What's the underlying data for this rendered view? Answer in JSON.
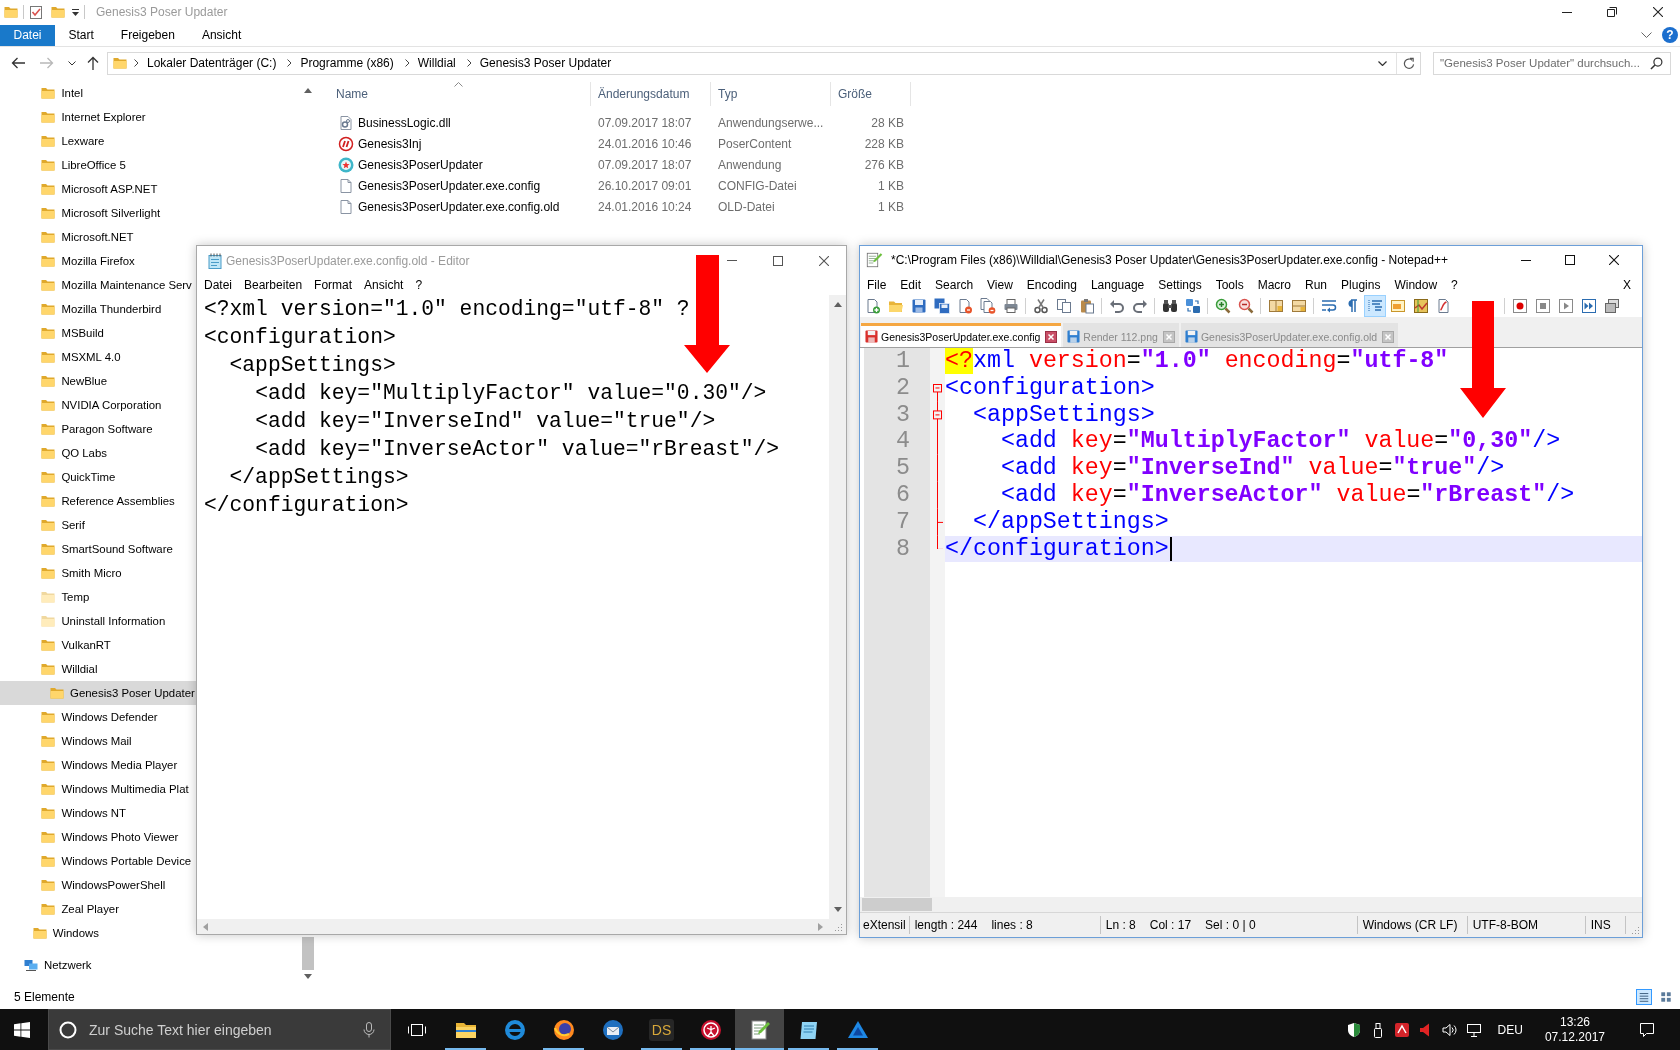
{
  "explorer": {
    "title": "Genesis3 Poser Updater",
    "active": false,
    "ribbon_tabs": [
      {
        "label": "Datei",
        "selected": true
      },
      {
        "label": "Start",
        "selected": false
      },
      {
        "label": "Freigeben",
        "selected": false
      },
      {
        "label": "Ansicht",
        "selected": false
      }
    ],
    "help": "?",
    "nav_buttons": [
      {
        "disabled": false
      },
      {
        "disabled": true
      },
      {
        "disabled": false
      },
      {
        "disabled": false
      }
    ],
    "breadcrumbs": [
      "Lokaler Datenträger (C:)",
      "Programme (x86)",
      "Willdial",
      "Genesis3 Poser Updater"
    ],
    "search": {
      "placeholder": "\"Genesis3 Poser Updater\" durchsuch..."
    },
    "navigation": [
      {
        "children": [
          {
            "children": [
              {
                "label": "Intel",
                "kind": "folder",
                "selected": false
              },
              {
                "label": "Internet Explorer",
                "kind": "folder",
                "selected": false
              },
              {
                "label": "Lexware",
                "kind": "folder",
                "selected": false
              },
              {
                "label": "LibreOffice 5",
                "kind": "folder",
                "selected": false
              },
              {
                "label": "Microsoft ASP.NET",
                "kind": "folder",
                "selected": false
              },
              {
                "label": "Microsoft Silverlight",
                "kind": "folder",
                "selected": false
              },
              {
                "label": "Microsoft.NET",
                "kind": "folder",
                "selected": false
              },
              {
                "label": "Mozilla Firefox",
                "kind": "folder",
                "selected": false
              },
              {
                "label": "Mozilla Maintenance Serv",
                "kind": "folder",
                "selected": false
              },
              {
                "label": "Mozilla Thunderbird",
                "kind": "folder",
                "selected": false
              },
              {
                "label": "MSBuild",
                "kind": "folder",
                "selected": false
              },
              {
                "label": "MSXML 4.0",
                "kind": "folder",
                "selected": false
              },
              {
                "label": "NewBlue",
                "kind": "folder",
                "selected": false
              },
              {
                "label": "NVIDIA Corporation",
                "kind": "folder",
                "selected": false
              },
              {
                "label": "Paragon Software",
                "kind": "folder",
                "selected": false
              },
              {
                "label": "QO Labs",
                "kind": "folder",
                "selected": false
              },
              {
                "label": "QuickTime",
                "kind": "folder",
                "selected": false
              },
              {
                "label": "Reference Assemblies",
                "kind": "folder",
                "selected": false
              },
              {
                "label": "Serif",
                "kind": "folder",
                "selected": false
              },
              {
                "label": "SmartSound Software",
                "kind": "folder",
                "selected": false
              },
              {
                "label": "Smith Micro",
                "kind": "folder",
                "selected": false
              },
              {
                "label": "Temp",
                "kind": "hidden-folder",
                "selected": false
              },
              {
                "label": "Uninstall Information",
                "kind": "hidden-folder",
                "selected": false
              },
              {
                "label": "VulkanRT",
                "kind": "folder",
                "selected": false
              },
              {
                "label": "Willdial",
                "kind": "folder",
                "selected": false,
                "children": [
                  {
                    "label": "Genesis3 Poser Updater",
                    "kind": "folder",
                    "selected": true
                  }
                ]
              },
              {
                "label": "Windows Defender",
                "kind": "folder",
                "selected": false
              },
              {
                "label": "Windows Mail",
                "kind": "folder",
                "selected": false
              },
              {
                "label": "Windows Media Player",
                "kind": "folder",
                "selected": false
              },
              {
                "label": "Windows Multimedia Plat",
                "kind": "folder",
                "selected": false
              },
              {
                "label": "Windows NT",
                "kind": "folder",
                "selected": false
              },
              {
                "label": "Windows Photo Viewer",
                "kind": "folder",
                "selected": false
              },
              {
                "label": "Windows Portable Device",
                "kind": "folder",
                "selected": false
              },
              {
                "label": "WindowsPowerShell",
                "kind": "folder",
                "selected": false
              },
              {
                "label": "Zeal Player",
                "kind": "folder",
                "selected": false
              }
            ]
          },
          {
            "label": "Windows",
            "kind": "folder",
            "selected": false
          }
        ]
      },
      {
        "label": "Netzwerk",
        "kind": "network",
        "selected": false
      }
    ],
    "columns": [
      {
        "label": "Name",
        "sorted": true
      },
      {
        "label": "Änderungsdatum",
        "sorted": false
      },
      {
        "label": "Typ",
        "sorted": false
      },
      {
        "label": "Größe",
        "sorted": false
      }
    ],
    "files": [
      {
        "kind": "library",
        "name": "BusinessLogic.dll",
        "modified": "07.09.2017 18:07",
        "type": "Anwendungserwe...",
        "size": "28 KB"
      },
      {
        "kind": "poser",
        "name": "Genesis3Inj",
        "modified": "24.01.2016 10:46",
        "type": "PoserContent",
        "size": "228 KB"
      },
      {
        "kind": "application",
        "name": "Genesis3PoserUpdater",
        "modified": "07.09.2017 18:07",
        "type": "Anwendung",
        "size": "276 KB"
      },
      {
        "kind": "document",
        "name": "Genesis3PoserUpdater.exe.config",
        "modified": "26.10.2017 09:01",
        "type": "CONFIG-Datei",
        "size": "1 KB"
      },
      {
        "kind": "document",
        "name": "Genesis3PoserUpdater.exe.config.old",
        "modified": "24.01.2016 10:24",
        "type": "OLD-Datei",
        "size": "1 KB"
      }
    ],
    "status": "5 Elemente",
    "view_buttons": [
      {
        "selected": true
      },
      {
        "selected": false
      }
    ]
  },
  "editor": {
    "title": "Genesis3PoserUpdater.exe.config.old - Editor",
    "active": false,
    "menu": [
      "Datei",
      "Bearbeiten",
      "Format",
      "Ansicht",
      "?"
    ],
    "lines": [
      "<?xml version=\"1.0\" encoding=\"utf-8\" ?",
      "<configuration>",
      "  <appSettings>",
      "    <add key=\"MultiplyFactor\" value=\"0.30\"/>",
      "    <add key=\"InverseInd\" value=\"true\"/>",
      "    <add key=\"InverseActor\" value=\"rBreast\"/>",
      "  </appSettings>",
      "</configuration>"
    ]
  },
  "notepad_plus_plus": {
    "title": "*C:\\Program Files (x86)\\Willdial\\Genesis3 Poser Updater\\Genesis3PoserUpdater.exe.config - Notepad++",
    "active": true,
    "menu": [
      "File",
      "Edit",
      "Search",
      "View",
      "Encoding",
      "Language",
      "Settings",
      "Tools",
      "Macro",
      "Run",
      "Plugins",
      "Window",
      "?"
    ],
    "close_document": "X",
    "toolbar": [
      [
        {
          "pressed": false
        },
        {
          "pressed": false
        },
        {
          "pressed": false
        },
        {
          "pressed": false
        },
        {
          "pressed": false
        },
        {
          "pressed": false
        },
        {
          "pressed": false
        }
      ],
      [
        {
          "pressed": false
        },
        {
          "pressed": false
        },
        {
          "pressed": false
        }
      ],
      [
        {
          "pressed": false
        },
        {
          "pressed": false
        }
      ],
      [
        {
          "pressed": false
        },
        {
          "pressed": false
        }
      ],
      [
        {
          "pressed": false
        },
        {
          "pressed": false
        }
      ],
      [
        {
          "pressed": false
        },
        {
          "pressed": false
        }
      ],
      [
        {
          "pressed": false
        },
        {
          "pressed": false
        },
        {
          "pressed": true
        },
        {
          "pressed": false
        },
        {
          "pressed": false
        },
        {
          "pressed": false
        }
      ],
      [
        {
          "pressed": false
        },
        {
          "pressed": false
        },
        {
          "pressed": false
        },
        {
          "pressed": false
        },
        {
          "pressed": false
        }
      ]
    ],
    "tabs": [
      {
        "label": "Genesis3PoserUpdater.exe.config",
        "selected": true,
        "modified": true
      },
      {
        "label": "Render 112.png",
        "selected": false,
        "modified": false
      },
      {
        "label": "Genesis3PoserUpdater.exe.config.old",
        "selected": false,
        "modified": false
      }
    ],
    "lines": [
      {
        "number": "1",
        "kind": "plain",
        "current": false,
        "tokens": [
          {
            "text": "<?",
            "kind": "pi"
          },
          {
            "text": "xml",
            "kind": "tag"
          },
          {
            "text": " version",
            "kind": "attr"
          },
          {
            "text": "=",
            "kind": "plain"
          },
          {
            "text": "\"1.0\"",
            "kind": "value"
          },
          {
            "text": " encoding",
            "kind": "attr"
          },
          {
            "text": "=",
            "kind": "plain"
          },
          {
            "text": "\"utf-8\"",
            "kind": "value"
          }
        ]
      },
      {
        "number": "2",
        "kind": "fold-start",
        "current": false,
        "tokens": [
          {
            "text": "<configuration>",
            "kind": "tag"
          }
        ]
      },
      {
        "number": "3",
        "kind": "fold-start",
        "current": false,
        "tokens": [
          {
            "text": "  <appSettings>",
            "kind": "tag"
          }
        ]
      },
      {
        "number": "4",
        "kind": "fold-body",
        "current": false,
        "tokens": [
          {
            "text": "    <add",
            "kind": "tag"
          },
          {
            "text": " key",
            "kind": "attr"
          },
          {
            "text": "=",
            "kind": "plain"
          },
          {
            "text": "\"MultiplyFactor\"",
            "kind": "value"
          },
          {
            "text": " value",
            "kind": "attr"
          },
          {
            "text": "=",
            "kind": "plain"
          },
          {
            "text": "\"0,30\"",
            "kind": "value"
          },
          {
            "text": "/>",
            "kind": "tag"
          }
        ]
      },
      {
        "number": "5",
        "kind": "fold-body",
        "current": false,
        "tokens": [
          {
            "text": "    <add",
            "kind": "tag"
          },
          {
            "text": " key",
            "kind": "attr"
          },
          {
            "text": "=",
            "kind": "plain"
          },
          {
            "text": "\"InverseInd\"",
            "kind": "value"
          },
          {
            "text": " value",
            "kind": "attr"
          },
          {
            "text": "=",
            "kind": "plain"
          },
          {
            "text": "\"true\"",
            "kind": "value"
          },
          {
            "text": "/>",
            "kind": "tag"
          }
        ]
      },
      {
        "number": "6",
        "kind": "fold-body",
        "current": false,
        "tokens": [
          {
            "text": "    <add",
            "kind": "tag"
          },
          {
            "text": " key",
            "kind": "attr"
          },
          {
            "text": "=",
            "kind": "plain"
          },
          {
            "text": "\"InverseActor\"",
            "kind": "value"
          },
          {
            "text": " value",
            "kind": "attr"
          },
          {
            "text": "=",
            "kind": "plain"
          },
          {
            "text": "\"rBreast\"",
            "kind": "value"
          },
          {
            "text": "/>",
            "kind": "tag"
          }
        ]
      },
      {
        "number": "7",
        "kind": "fold-end",
        "current": false,
        "tokens": [
          {
            "text": "  </appSettings>",
            "kind": "tag"
          }
        ]
      },
      {
        "number": "8",
        "kind": "fold-end",
        "current": true,
        "tokens": [
          {
            "text": "</configuration>",
            "kind": "tag"
          }
        ]
      }
    ],
    "status": [
      [
        "eXtensil"
      ],
      [
        "length : 244",
        "lines : 8"
      ],
      [
        "Ln : 8",
        "Col : 17",
        "Sel : 0 | 0"
      ],
      [
        "Windows (CR LF)"
      ],
      [
        "UTF-8-BOM"
      ],
      [
        "INS"
      ]
    ]
  },
  "taskbar": {
    "search": {
      "placeholder": "Zur Suche Text hier eingeben"
    },
    "apps": [
      {
        "running": true,
        "active": false
      },
      {
        "running": false,
        "active": false
      },
      {
        "running": true,
        "active": false
      },
      {
        "running": false,
        "active": false
      },
      {
        "label": "DS",
        "running": true,
        "active": false
      },
      {
        "running": true,
        "active": false
      },
      {
        "running": true,
        "active": true
      },
      {
        "running": true,
        "active": false
      },
      {
        "running": true,
        "active": false
      }
    ],
    "tray": {
      "language": "DEU",
      "time": "13:26",
      "date": "07.12.2017"
    }
  }
}
